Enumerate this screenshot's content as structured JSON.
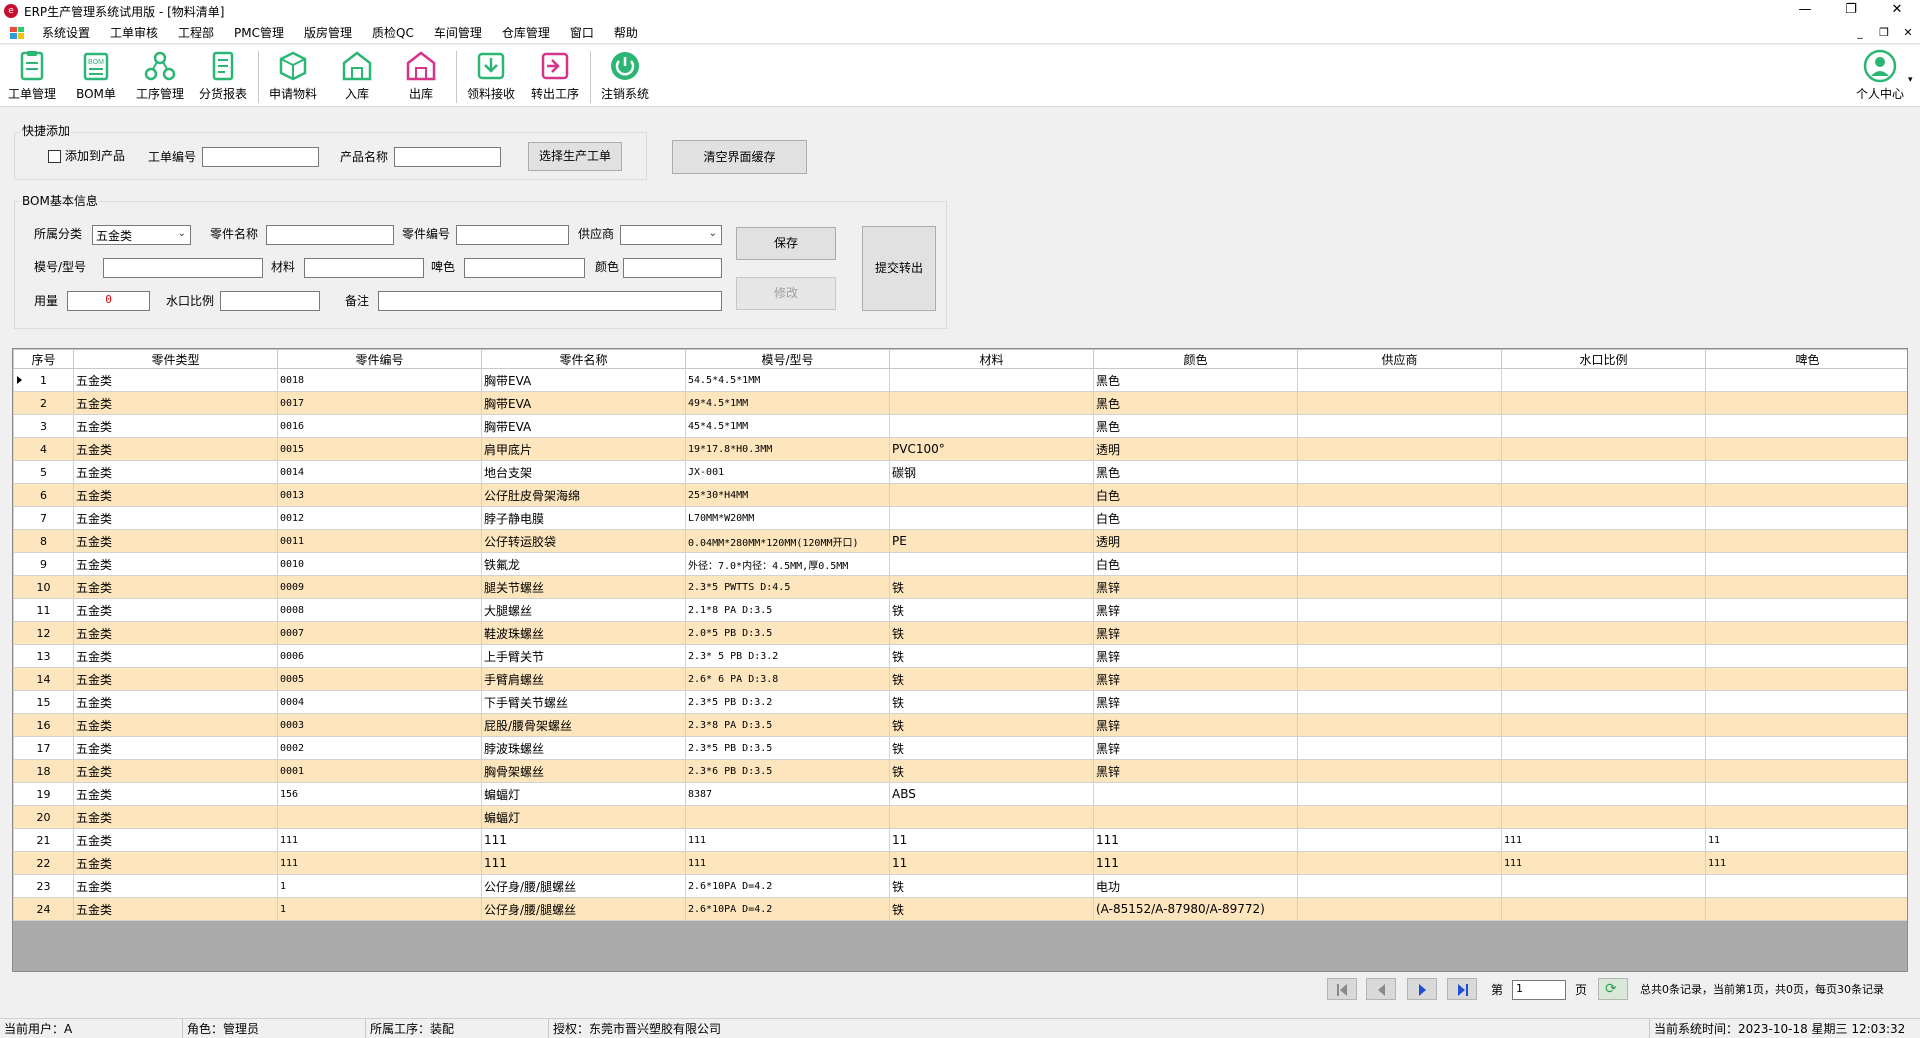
{
  "window": {
    "title": "ERP生产管理系统试用版 - [物料清单]",
    "controls": [
      "—",
      "❐",
      "✕"
    ]
  },
  "menu": {
    "items": [
      "系统设置",
      "工单审核",
      "工程部",
      "PMC管理",
      "版房管理",
      "质检QC",
      "车间管理",
      "仓库管理",
      "窗口",
      "帮助"
    ],
    "mdi_controls": [
      "_",
      "❐",
      "✕"
    ]
  },
  "toolbar": {
    "items": [
      {
        "label": "工单管理",
        "icon": "clipboard-icon",
        "color": "#2bb673"
      },
      {
        "label": "BOM单",
        "icon": "bom-list-icon",
        "color": "#2bb673"
      },
      {
        "label": "工序管理",
        "icon": "process-nodes-icon",
        "color": "#2bb673"
      },
      {
        "label": "分货报表",
        "icon": "report-icon",
        "color": "#2bb673"
      },
      {
        "label": "申请物料",
        "icon": "box-icon",
        "color": "#2bb673"
      },
      {
        "label": "入库",
        "icon": "warehouse-in-icon",
        "color": "#2bb673"
      },
      {
        "label": "出库",
        "icon": "warehouse-out-icon",
        "color": "#d6338a"
      },
      {
        "label": "领料接收",
        "icon": "receive-icon",
        "color": "#2bb673"
      },
      {
        "label": "转出工序",
        "icon": "transfer-icon",
        "color": "#d6338a"
      },
      {
        "label": "注销系统",
        "icon": "power-icon",
        "color": "#2bb673"
      }
    ],
    "user_center": {
      "label": "个人中心",
      "icon": "user-avatar-icon",
      "caret": "▾"
    }
  },
  "quick_add": {
    "title": "快捷添加",
    "add_to_product_label": "添加到产品",
    "order_no_label": "工单编号",
    "order_no_value": "",
    "product_name_label": "产品名称",
    "product_name_value": "",
    "select_order_button": "选择生产工单",
    "clear_cache_button": "清空界面缓存"
  },
  "bom_info": {
    "title": "BOM基本信息",
    "category_label": "所属分类",
    "category_value": "五金类",
    "part_name_label": "零件名称",
    "part_name_value": "",
    "part_no_label": "零件编号",
    "part_no_value": "",
    "supplier_label": "供应商",
    "supplier_value": "",
    "model_label": "模号/型号",
    "model_value": "",
    "material_label": "材料",
    "material_value": "",
    "spray_color_label": "啤色",
    "spray_color_value": "",
    "color_label": "颜色",
    "color_value": "",
    "usage_label": "用量",
    "usage_value": "0",
    "water_ratio_label": "水口比例",
    "water_ratio_value": "",
    "remark_label": "备注",
    "remark_value": "",
    "save_button": "保存",
    "modify_button": "修改",
    "submit_button": "提交转出"
  },
  "table": {
    "columns": [
      "序号",
      "零件类型",
      "零件编号",
      "零件名称",
      "模号/型号",
      "材料",
      "颜色",
      "供应商",
      "水口比例",
      "啤色"
    ],
    "rows": [
      [
        "1",
        "五金类",
        "0018",
        "胸带EVA",
        "54.5*4.5*1MM",
        "",
        "黑色",
        "",
        "",
        ""
      ],
      [
        "2",
        "五金类",
        "0017",
        "胸带EVA",
        "49*4.5*1MM",
        "",
        "黑色",
        "",
        "",
        ""
      ],
      [
        "3",
        "五金类",
        "0016",
        "胸带EVA",
        "45*4.5*1MM",
        "",
        "黑色",
        "",
        "",
        ""
      ],
      [
        "4",
        "五金类",
        "0015",
        "肩甲底片",
        "19*17.8*H0.3MM",
        "PVC100°",
        "透明",
        "",
        "",
        ""
      ],
      [
        "5",
        "五金类",
        "0014",
        "地台支架",
        "JX-001",
        "碳钢",
        "黑色",
        "",
        "",
        ""
      ],
      [
        "6",
        "五金类",
        "0013",
        "公仔肚皮骨架海绵",
        "25*30*H4MM",
        "",
        "白色",
        "",
        "",
        ""
      ],
      [
        "7",
        "五金类",
        "0012",
        "脖子静电膜",
        "L70MM*W20MM",
        "",
        "白色",
        "",
        "",
        ""
      ],
      [
        "8",
        "五金类",
        "0011",
        "公仔转运胶袋",
        "0.04MM*280MM*120MM(120MM开口)",
        "PE",
        "透明",
        "",
        "",
        ""
      ],
      [
        "9",
        "五金类",
        "0010",
        "铁氟龙",
        "外径：7.0*内径：4.5MM,厚0.5MM",
        "",
        "白色",
        "",
        "",
        ""
      ],
      [
        "10",
        "五金类",
        "0009",
        "腿关节螺丝",
        "2.3*5  PWTTS D:4.5",
        "铁",
        "黑锌",
        "",
        "",
        ""
      ],
      [
        "11",
        "五金类",
        "0008",
        "大腿螺丝",
        "2.1*8  PA D:3.5",
        "铁",
        "黑锌",
        "",
        "",
        ""
      ],
      [
        "12",
        "五金类",
        "0007",
        "鞋波珠螺丝",
        "2.0*5  PB D:3.5",
        "铁",
        "黑锌",
        "",
        "",
        ""
      ],
      [
        "13",
        "五金类",
        "0006",
        "上手臂关节",
        "2.3* 5  PB D:3.2",
        "铁",
        "黑锌",
        "",
        "",
        ""
      ],
      [
        "14",
        "五金类",
        "0005",
        "手臂肩螺丝",
        "2.6* 6  PA D:3.8",
        "铁",
        "黑锌",
        "",
        "",
        ""
      ],
      [
        "15",
        "五金类",
        "0004",
        "下手臂关节螺丝",
        "2.3*5  PB D:3.2",
        "铁",
        "黑锌",
        "",
        "",
        ""
      ],
      [
        "16",
        "五金类",
        "0003",
        "屁股/腰骨架螺丝",
        "2.3*8  PA D:3.5",
        "铁",
        "黑锌",
        "",
        "",
        ""
      ],
      [
        "17",
        "五金类",
        "0002",
        "脖波珠螺丝",
        "2.3*5  PB D:3.5",
        "铁",
        "黑锌",
        "",
        "",
        ""
      ],
      [
        "18",
        "五金类",
        "0001",
        "胸骨架螺丝",
        "2.3*6  PB D:3.5",
        "铁",
        "黑锌",
        "",
        "",
        ""
      ],
      [
        "19",
        "五金类",
        "156",
        "蝙蝠灯",
        "8387",
        "ABS",
        "",
        "",
        "",
        ""
      ],
      [
        "20",
        "五金类",
        "",
        "蝙蝠灯",
        "",
        "",
        "",
        "",
        "",
        ""
      ],
      [
        "21",
        "五金类",
        "111",
        "111",
        "111",
        "11",
        "111",
        "",
        "111",
        "11"
      ],
      [
        "22",
        "五金类",
        "111",
        "111",
        "111",
        "11",
        "111",
        "",
        "111",
        "111"
      ],
      [
        "23",
        "五金类",
        "1",
        "公仔身/腰/腿螺丝",
        "2.6*10PA D=4.2",
        "铁",
        "电功",
        "",
        "",
        ""
      ],
      [
        "24",
        "五金类",
        "1",
        "公仔身/腰/腿螺丝",
        "2.6*10PA D=4.2",
        "铁",
        "(A-85152/A-87980/A-89772)",
        "",
        "",
        ""
      ]
    ]
  },
  "pager": {
    "page_prefix": "第",
    "page_value": "1",
    "page_suffix": "页",
    "summary": "总共0条记录，当前第1页，共0页，每页30条记录"
  },
  "status": {
    "user": "当前用户：A",
    "role": "角色：管理员",
    "process": "所属工序：装配",
    "license": "授权：东莞市晋兴塑胶有限公司",
    "time": "当前系统时间：2023-10-18 星期三 12:03:32"
  }
}
